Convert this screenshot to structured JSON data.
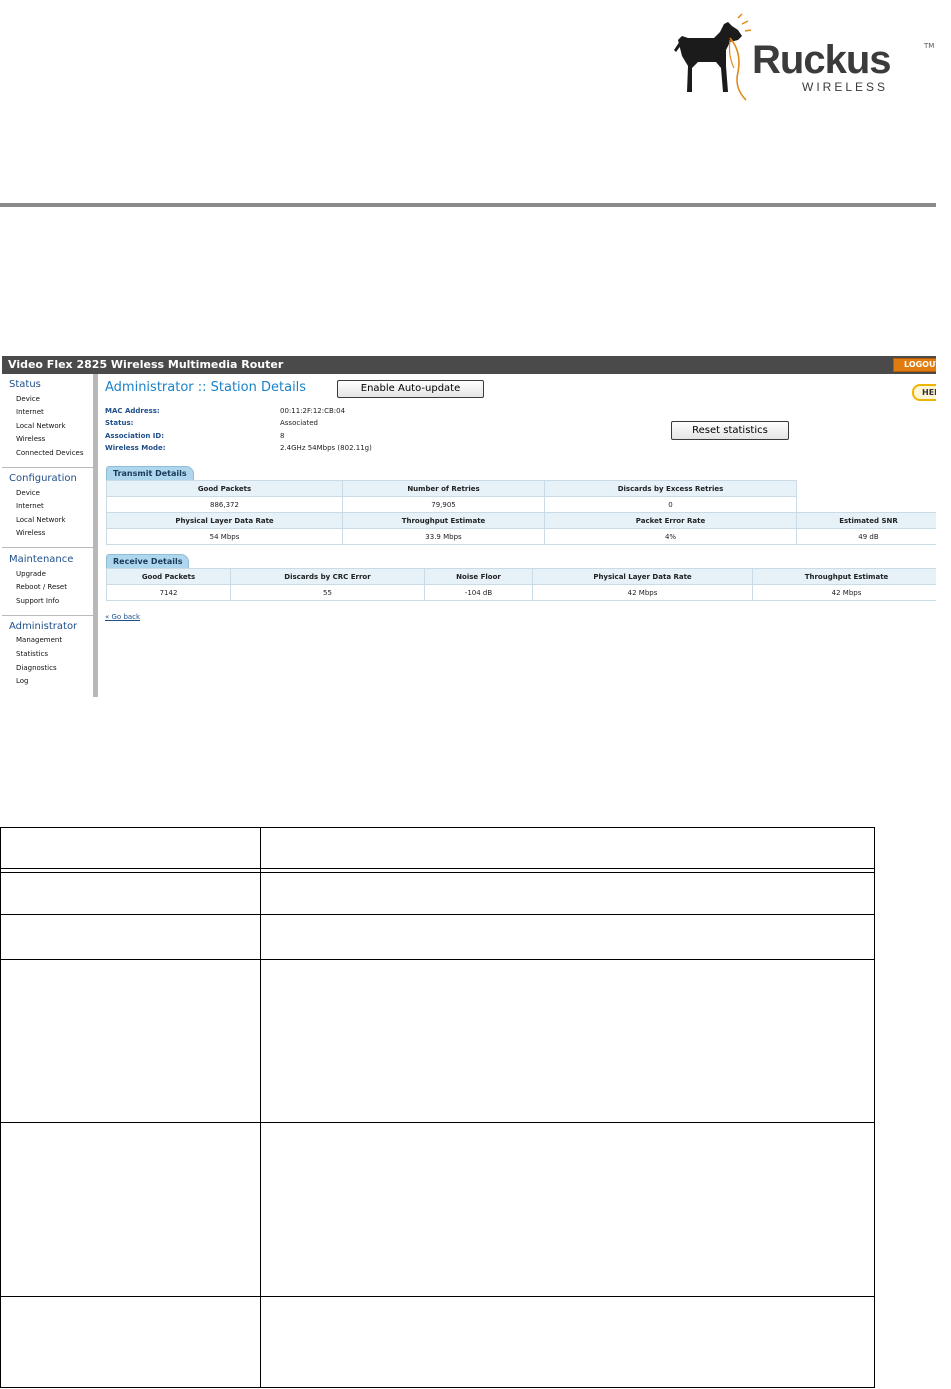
{
  "logo": {
    "word": "Ruckus",
    "tm": "TM",
    "sub": "WIRELESS",
    "brand_color": "#3b3b3b",
    "leash_color": "#e08a1a"
  },
  "router": {
    "title": "Video Flex 2825 Wireless Multimedia Router",
    "logout_label": "LOGOUT",
    "help_label": "HELP",
    "sidebar": {
      "status": {
        "heading": "Status",
        "items": [
          "Device",
          "Internet",
          "Local Network",
          "Wireless",
          "Connected Devices"
        ]
      },
      "configuration": {
        "heading": "Configuration",
        "items": [
          "Device",
          "Internet",
          "Local Network",
          "Wireless"
        ]
      },
      "maintenance": {
        "heading": "Maintenance",
        "items": [
          "Upgrade",
          "Reboot / Reset",
          "Support Info"
        ]
      },
      "administrator": {
        "heading": "Administrator",
        "items": [
          "Management",
          "Statistics",
          "Diagnostics",
          "Log"
        ]
      }
    },
    "page_heading": "Administrator :: Station Details",
    "auto_update_label": "Enable Auto-update",
    "reset_label": "Reset statistics",
    "station": {
      "mac_label": "MAC Address:",
      "mac_value": "00:11:2F:12:CB:04",
      "status_label": "Status:",
      "status_value": "Associated",
      "assoc_label": "Association ID:",
      "assoc_value": "8",
      "mode_label": "Wireless Mode:",
      "mode_value": "2.4GHz 54Mbps (802.11g)"
    },
    "transmit": {
      "tab_label": "Transmit Details",
      "row1_headers": [
        "Good Packets",
        "Number of Retries",
        "Discards by Excess Retries"
      ],
      "row1_values": [
        "886,372",
        "79,905",
        "0"
      ],
      "row2_headers": [
        "Physical Layer Data Rate",
        "Throughput Estimate",
        "Packet Error Rate",
        "Estimated SNR"
      ],
      "row2_values": [
        "54 Mbps",
        "33.9 Mbps",
        "4%",
        "49 dB"
      ]
    },
    "receive": {
      "tab_label": "Receive Details",
      "headers": [
        "Good Packets",
        "Discards by CRC Error",
        "Noise Floor",
        "Physical Layer Data Rate",
        "Throughput Estimate"
      ],
      "values": [
        "7142",
        "55",
        "-104 dB",
        "42 Mbps",
        "42 Mbps"
      ]
    },
    "go_back": "« Go back"
  }
}
